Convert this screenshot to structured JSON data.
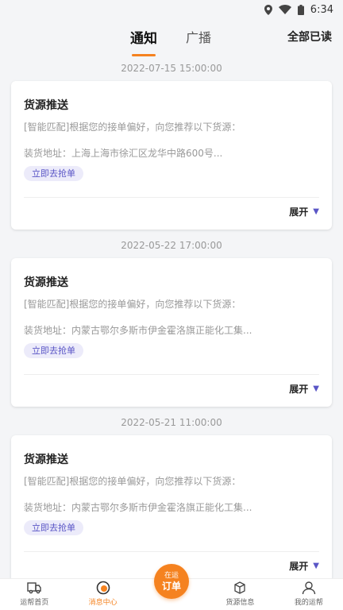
{
  "status_bar": {
    "time": "6:34"
  },
  "header": {
    "tabs": [
      {
        "label": "通知",
        "active": true
      },
      {
        "label": "广播",
        "active": false
      }
    ],
    "mark_all_label": "全部已读"
  },
  "notifications": [
    {
      "timestamp": "2022-07-15 15:00:00",
      "title": "货源推送",
      "description": "[智能匹配]根据您的接单偏好，向您推荐以下货源：",
      "address": "装货地址：上海上海市徐汇区龙华中路600号...",
      "action_label": "立即去抢单",
      "expand_label": "展开"
    },
    {
      "timestamp": "2022-05-22 17:00:00",
      "title": "货源推送",
      "description": "[智能匹配]根据您的接单偏好，向您推荐以下货源：",
      "address": "装货地址：内蒙古鄂尔多斯市伊金霍洛旗正能化工集...",
      "action_label": "立即去抢单",
      "expand_label": "展开"
    },
    {
      "timestamp": "2022-05-21 11:00:00",
      "title": "货源推送",
      "description": "[智能匹配]根据您的接单偏好，向您推荐以下货源：",
      "address": "装货地址：内蒙古鄂尔多斯市伊金霍洛旗正能化工集...",
      "action_label": "立即去抢单",
      "expand_label": "展开"
    }
  ],
  "bottom_nav": {
    "items": [
      {
        "label": "运帮首页",
        "icon": "truck-icon"
      },
      {
        "label": "消息中心",
        "icon": "message-icon",
        "active": true
      },
      {
        "label": "货源信息",
        "icon": "box-icon"
      },
      {
        "label": "我的运帮",
        "icon": "user-icon"
      }
    ],
    "fab": {
      "top": "在运",
      "bottom": "订单"
    }
  },
  "colors": {
    "accent": "#f5821f",
    "tag": "#5a56c6"
  }
}
